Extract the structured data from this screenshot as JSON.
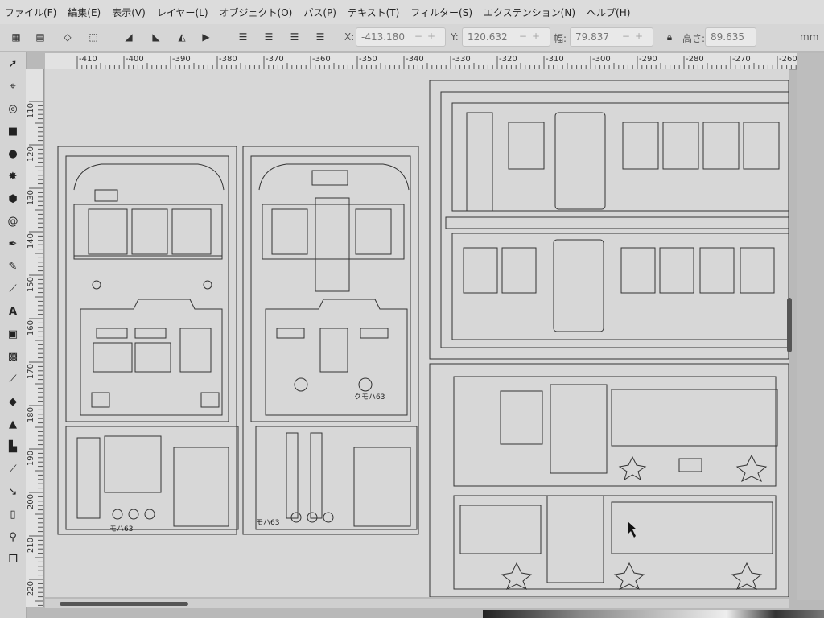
{
  "menu": [
    "ファイル(F)",
    "編集(E)",
    "表示(V)",
    "レイヤー(L)",
    "オブジェクト(O)",
    "パス(P)",
    "テキスト(T)",
    "フィルター(S)",
    "エクステンション(N)",
    "ヘルプ(H)"
  ],
  "toolbar": {
    "x_label": "X:",
    "x_value": "-413.180",
    "y_label": "Y:",
    "y_value": "120.632",
    "w_label": "幅:",
    "w_value": "79.837",
    "h_label": "高さ:",
    "h_value": "89.635",
    "unit": "mm"
  },
  "ruler": {
    "top_ticks": [
      "-410",
      "-400",
      "-390",
      "-380",
      "-370",
      "-360",
      "-350",
      "-340",
      "-330",
      "-320",
      "-310",
      "-300",
      "-290",
      "-280",
      "-270",
      "-260"
    ],
    "left_ticks": [
      "110",
      "120",
      "130",
      "140",
      "150",
      "160",
      "170",
      "180",
      "190",
      "200",
      "210",
      "220"
    ]
  },
  "drawing": {
    "part_label_1": "モハ63",
    "part_label_2": "モハ63",
    "side_note": "クモハ63"
  }
}
